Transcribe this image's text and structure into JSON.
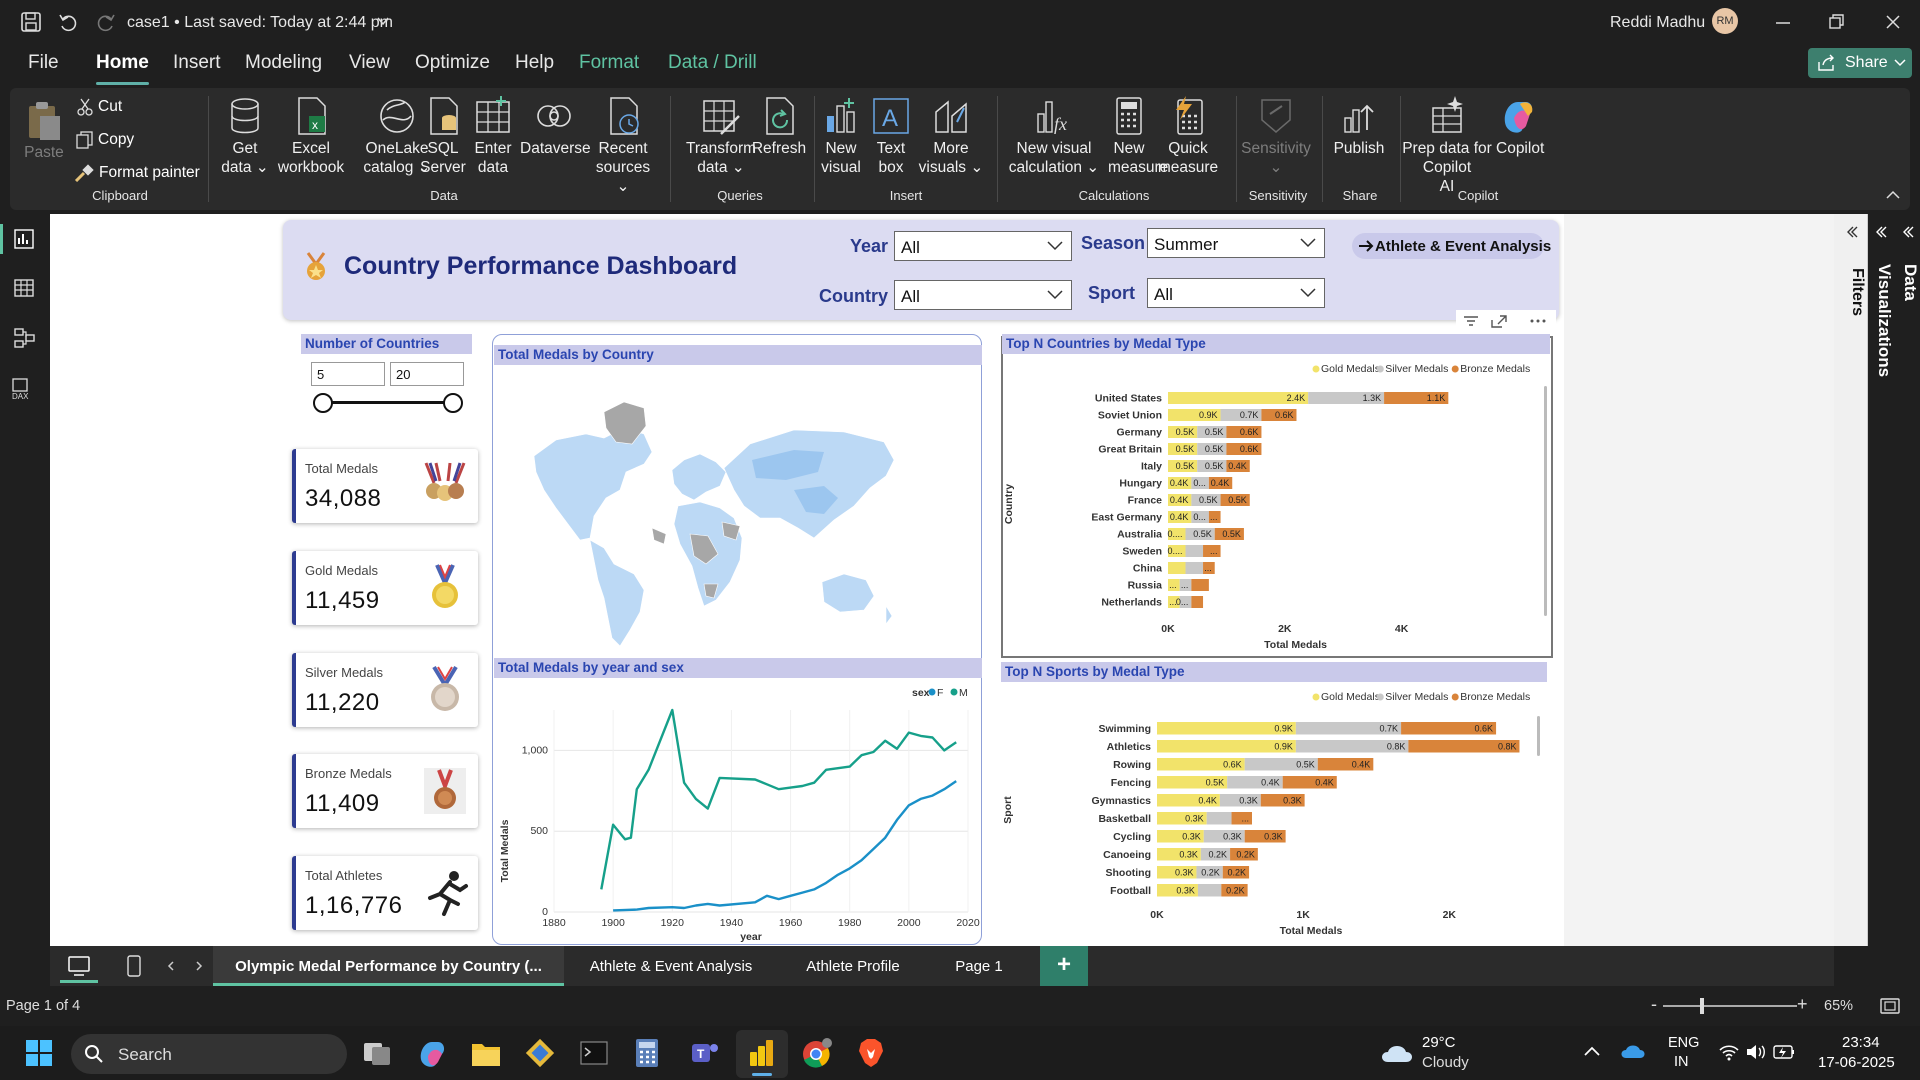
{
  "titlebar": {
    "file_title": "case1 • Last saved: Today at 2:44 pm",
    "user_name": "Reddi Madhu",
    "user_initials": "RM"
  },
  "menu": {
    "items": [
      "File",
      "Home",
      "Insert",
      "Modeling",
      "View",
      "Optimize",
      "Help",
      "Format",
      "Data / Drill"
    ],
    "active": "Home",
    "share": "Share"
  },
  "ribbon": {
    "clipboard": {
      "paste": "Paste",
      "cut": "Cut",
      "copy": "Copy",
      "format_painter": "Format painter",
      "group": "Clipboard"
    },
    "data": {
      "get_data": [
        "Get",
        "data"
      ],
      "excel": [
        "Excel",
        "workbook"
      ],
      "onelake": [
        "OneLake",
        "catalog"
      ],
      "sql": [
        "SQL",
        "Server"
      ],
      "enter": [
        "Enter",
        "data"
      ],
      "dataverse": [
        "Dataverse"
      ],
      "recent": [
        "Recent",
        "sources"
      ],
      "group": "Data"
    },
    "queries": {
      "transform": [
        "Transform",
        "data"
      ],
      "refresh": [
        "Refresh"
      ],
      "group": "Queries"
    },
    "insert": {
      "new_visual": [
        "New",
        "visual"
      ],
      "text_box": [
        "Text",
        "box"
      ],
      "more_visuals": [
        "More",
        "visuals"
      ],
      "group": "Insert"
    },
    "calculations": {
      "new_calc": [
        "New visual",
        "calculation"
      ],
      "new_measure": [
        "New",
        "measure"
      ],
      "quick_measure": [
        "Quick",
        "measure"
      ],
      "group": "Calculations"
    },
    "sensitivity": {
      "label": "Sensitivity",
      "group": "Sensitivity"
    },
    "share": {
      "publish": "Publish",
      "group": "Share"
    },
    "copilot": {
      "prep": [
        "Prep data for Copilot",
        "AI"
      ],
      "group": "Copilot"
    }
  },
  "dashboard": {
    "title": "Country Performance Dashboard",
    "filters": {
      "year_label": "Year",
      "year_value": "All",
      "season_label": "Season",
      "season_value": "Summer",
      "country_label": "Country",
      "country_value": "All",
      "sport_label": "Sport",
      "sport_value": "All"
    },
    "nav_button": "Athlete & Event Analysis",
    "slider": {
      "title": "Number of Countries",
      "min": "5",
      "max": "20"
    },
    "kpis": [
      {
        "title": "Total Medals",
        "value": "34,088",
        "icon": "medals-icon"
      },
      {
        "title": "Gold Medals",
        "value": "11,459",
        "icon": "gold-medal-icon"
      },
      {
        "title": "Silver Medals",
        "value": "11,220",
        "icon": "silver-medal-icon"
      },
      {
        "title": "Bronze Medals",
        "value": "11,409",
        "icon": "bronze-medal-icon"
      },
      {
        "title": "Total Athletes",
        "value": "1,16,776",
        "icon": "runner-icon"
      }
    ],
    "map_title": "Total Medals by Country",
    "line_title": "Total Medals by year and sex",
    "countries_title": "Top N Countries by Medal Type",
    "sports_title": "Top N Sports by Medal Type"
  },
  "chart_data": [
    {
      "type": "bar",
      "stacked": true,
      "orientation": "horizontal",
      "title": "Top N Countries by Medal Type",
      "xlabel": "Total Medals",
      "ylabel": "Country",
      "xlim": [
        0,
        5000
      ],
      "xticks": [
        "0K",
        "2K",
        "4K"
      ],
      "legend_position": "top-right",
      "categories": [
        "United States",
        "Soviet Union",
        "Germany",
        "Great Britain",
        "Italy",
        "Hungary",
        "France",
        "East Germany",
        "Australia",
        "Sweden",
        "China",
        "Russia",
        "Netherlands"
      ],
      "series": [
        {
          "name": "Gold Medals",
          "color": "#f2e36a",
          "values": [
            2400,
            900,
            500,
            500,
            500,
            400,
            400,
            400,
            300,
            300,
            300,
            200,
            200
          ],
          "labels": [
            "2.4K",
            "0.9K",
            "0.5K",
            "0.5K",
            "0.5K",
            "0.4K",
            "0.4K",
            "0.4K",
            "0....",
            "0....",
            "",
            "...",
            "..."
          ]
        },
        {
          "name": "Silver Medals",
          "color": "#c8c8c8",
          "values": [
            1300,
            700,
            500,
            500,
            500,
            300,
            500,
            300,
            500,
            300,
            300,
            200,
            200
          ],
          "labels": [
            "1.3K",
            "0.7K",
            "0.5K",
            "0.5K",
            "0.5K",
            "0...",
            "0.5K",
            "0...",
            "0.5K",
            "",
            "",
            "...",
            "0..."
          ]
        },
        {
          "name": "Bronze Medals",
          "color": "#d9843a",
          "values": [
            1100,
            600,
            600,
            600,
            400,
            400,
            500,
            200,
            500,
            300,
            200,
            300,
            200
          ],
          "labels": [
            "1.1K",
            "0.6K",
            "0.6K",
            "0.6K",
            "0.4K",
            "0.4K",
            "0.5K",
            "...",
            "0.5K",
            "...",
            "...",
            "",
            ""
          ]
        }
      ]
    },
    {
      "type": "bar",
      "stacked": true,
      "orientation": "horizontal",
      "title": "Top N Sports by Medal Type",
      "xlabel": "Total Medals",
      "ylabel": "Sport",
      "xlim": [
        0,
        2600
      ],
      "xticks": [
        "0K",
        "1K",
        "2K"
      ],
      "legend_position": "top-right",
      "categories": [
        "Swimming",
        "Athletics",
        "Rowing",
        "Fencing",
        "Gymnastics",
        "Basketball",
        "Cycling",
        "Canoeing",
        "Shooting",
        "Football"
      ],
      "series": [
        {
          "name": "Gold Medals",
          "color": "#f2e36a",
          "values": [
            950,
            950,
            600,
            480,
            430,
            340,
            320,
            300,
            270,
            280
          ],
          "labels": [
            "0.9K",
            "0.9K",
            "0.6K",
            "0.5K",
            "0.4K",
            "0.3K",
            "0.3K",
            "0.3K",
            "0.3K",
            "0.3K"
          ]
        },
        {
          "name": "Silver Medals",
          "color": "#c8c8c8",
          "values": [
            720,
            770,
            500,
            380,
            280,
            170,
            280,
            200,
            180,
            160
          ],
          "labels": [
            "0.7K",
            "0.8K",
            "0.5K",
            "0.4K",
            "0.3K",
            "",
            "0.3K",
            "0.2K",
            "0.2K",
            ""
          ]
        },
        {
          "name": "Bronze Medals",
          "color": "#d9843a",
          "values": [
            650,
            760,
            380,
            370,
            300,
            140,
            280,
            190,
            180,
            180
          ],
          "labels": [
            "0.6K",
            "0.8K",
            "0.4K",
            "0.4K",
            "0.3K",
            "...",
            "0.3K",
            "0.2K",
            "0.2K",
            "0.2K"
          ]
        }
      ]
    },
    {
      "type": "line",
      "title": "Total Medals by year and sex",
      "xlabel": "year",
      "ylabel": "Total Medals",
      "xlim": [
        1880,
        2020
      ],
      "ylim": [
        0,
        1250
      ],
      "xticks": [
        1880,
        1900,
        1920,
        1940,
        1960,
        1980,
        2000,
        2020
      ],
      "yticks": [
        0,
        500,
        1000
      ],
      "legend_title": "sex",
      "legend_position": "top-right",
      "series": [
        {
          "name": "F",
          "color": "#1a90c8",
          "x": [
            1900,
            1908,
            1912,
            1920,
            1924,
            1928,
            1932,
            1936,
            1948,
            1952,
            1956,
            1960,
            1964,
            1968,
            1972,
            1976,
            1980,
            1984,
            1988,
            1992,
            1996,
            2000,
            2004,
            2008,
            2012,
            2016
          ],
          "y": [
            10,
            15,
            25,
            30,
            25,
            40,
            50,
            40,
            60,
            100,
            80,
            100,
            120,
            140,
            180,
            230,
            270,
            320,
            390,
            460,
            570,
            660,
            700,
            720,
            760,
            810
          ]
        },
        {
          "name": "M",
          "color": "#16a08a",
          "x": [
            1896,
            1900,
            1904,
            1906,
            1908,
            1912,
            1920,
            1924,
            1928,
            1932,
            1936,
            1948,
            1952,
            1956,
            1960,
            1964,
            1968,
            1972,
            1976,
            1980,
            1984,
            1988,
            1992,
            1996,
            2000,
            2004,
            2008,
            2012,
            2016
          ],
          "y": [
            140,
            540,
            450,
            460,
            760,
            880,
            1250,
            800,
            700,
            640,
            830,
            820,
            790,
            760,
            770,
            780,
            800,
            880,
            890,
            900,
            970,
            990,
            1060,
            1010,
            1110,
            1090,
            1080,
            1000,
            1050
          ]
        }
      ]
    }
  ],
  "tabs": [
    "Olympic Medal Performance by Country (...",
    "Athlete & Event Analysis",
    "Athlete Profile",
    "Page 1"
  ],
  "active_tab": 0,
  "right_panes": {
    "filters": "Filters",
    "visualizations": "Visualizations",
    "data": "Data"
  },
  "status": {
    "page": "Page 1 of 4",
    "zoom": "65%"
  },
  "taskbar": {
    "search": "Search",
    "temp": "29°C",
    "weather": "Cloudy",
    "lang": "ENG",
    "region": "IN",
    "time": "23:34",
    "date": "17-06-2025"
  }
}
